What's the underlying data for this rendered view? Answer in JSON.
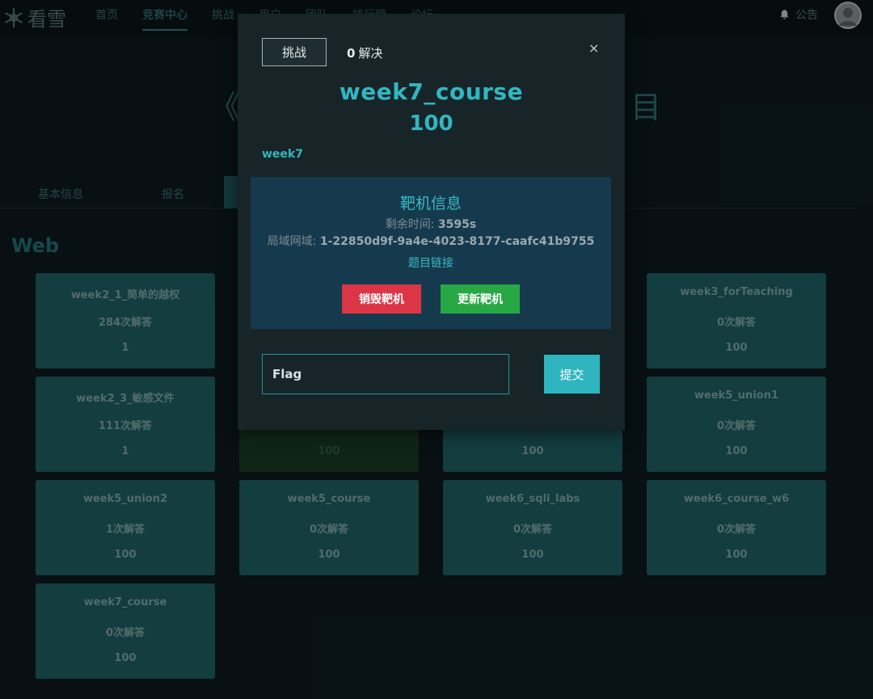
{
  "header": {
    "logo_text": "看雪",
    "nav": [
      "首页",
      "竞赛中心",
      "挑战",
      "用户",
      "团队",
      "排行榜",
      "论坛"
    ],
    "active_nav": "竞赛中心",
    "notice_label": "公告"
  },
  "page": {
    "title_left": "《C",
    "title_right": "目",
    "subtabs": [
      "基本信息",
      "报名"
    ],
    "section": "Web"
  },
  "cards": [
    {
      "name": "week2_1_简单的越权",
      "solves": "284次解答",
      "score": "1"
    },
    {
      "name": "week3_forTeaching",
      "solves": "0次解答",
      "score": "100"
    },
    {
      "name": "week2_3_敏感文件",
      "solves": "111次解答",
      "score": "1"
    },
    {
      "name": "",
      "solves": "",
      "score": "100"
    },
    {
      "name": "",
      "solves": "",
      "score": "100"
    },
    {
      "name": "week5_union1",
      "solves": "0次解答",
      "score": "100"
    },
    {
      "name": "week5_union2",
      "solves": "1次解答",
      "score": "100"
    },
    {
      "name": "week5_course",
      "solves": "0次解答",
      "score": "100"
    },
    {
      "name": "week6_sqli_labs",
      "solves": "0次解答",
      "score": "100"
    },
    {
      "name": "week6_course_w6",
      "solves": "0次解答",
      "score": "100"
    },
    {
      "name": "week7_course",
      "solves": "0次解答",
      "score": "100"
    }
  ],
  "modal": {
    "tab_label": "挑战",
    "solves_count": "0",
    "solves_label": "解决",
    "close": "×",
    "title": "week7_course",
    "score": "100",
    "tag": "week7",
    "target": {
      "heading": "靶机信息",
      "remaining_label": "剩余时间:",
      "remaining_value": "3595s",
      "lan_label": "局域网域:",
      "lan_value": "1-22850d9f-9a4e-4023-8177-caafc41b9755",
      "link": "题目链接",
      "destroy": "销毁靶机",
      "renew": "更新靶机"
    },
    "flag_placeholder": "Flag",
    "submit": "提交"
  },
  "colors": {
    "accent": "#31b7c0",
    "card": "#1e5f61",
    "solved_card": "#173b24",
    "destroy": "#dc3545",
    "renew": "#28a745"
  }
}
